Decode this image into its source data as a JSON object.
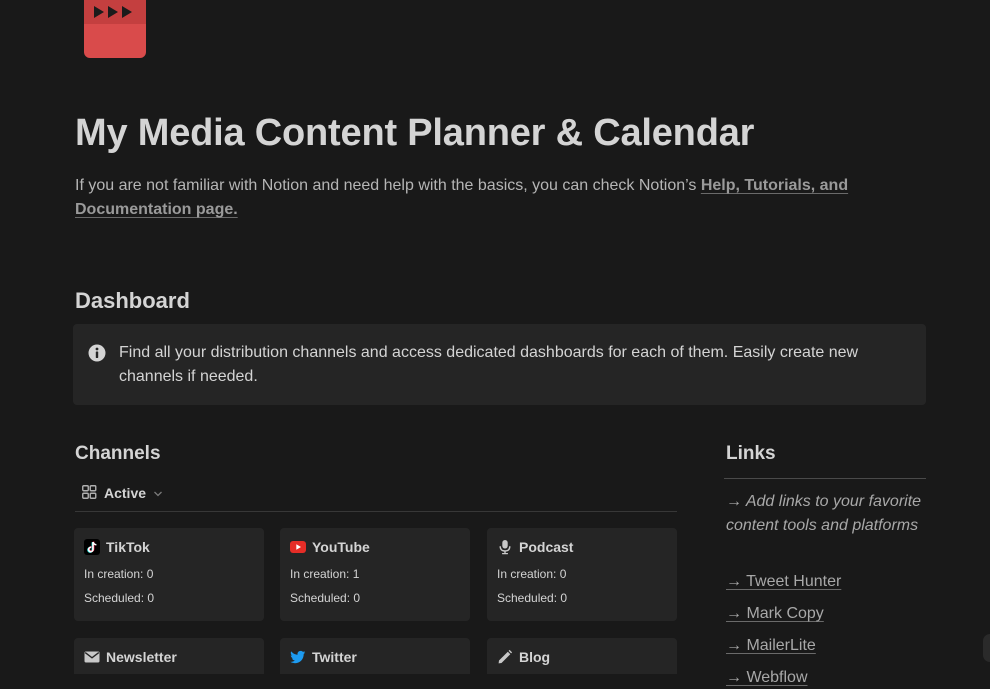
{
  "page": {
    "icon": "clapperboard-icon",
    "title": "My Media Content Planner & Calendar",
    "intro_text": "If you are not familiar with Notion and need help with the basics, you can check Notion’s ",
    "intro_link": "Help, Tutorials, and Documentation page."
  },
  "dashboard": {
    "heading": "Dashboard",
    "callout_icon": "info-icon",
    "callout_text": "Find all your distribution channels and access dedicated dashboards for each of them. Easily create new channels if needed."
  },
  "channels": {
    "heading": "Channels",
    "view_icon": "gallery-icon",
    "view_label": "Active",
    "cards": [
      {
        "name": "TikTok",
        "icon": "tiktok-icon",
        "in_creation": "In creation: 0",
        "scheduled": "Scheduled: 0"
      },
      {
        "name": "YouTube",
        "icon": "youtube-icon",
        "in_creation": "In creation: 1",
        "scheduled": "Scheduled: 0"
      },
      {
        "name": "Podcast",
        "icon": "microphone-icon",
        "in_creation": "In creation: 0",
        "scheduled": "Scheduled: 0"
      },
      {
        "name": "Newsletter",
        "icon": "envelope-icon"
      },
      {
        "name": "Twitter",
        "icon": "twitter-icon"
      },
      {
        "name": "Blog",
        "icon": "pencil-icon"
      }
    ]
  },
  "links": {
    "heading": "Links",
    "note": "→ Add links to your favorite content tools and platforms",
    "items": [
      "→ Tweet Hunter",
      "→ Mark Copy",
      "→ MailerLite",
      "→ Webflow"
    ]
  },
  "colors": {
    "background": "#191919",
    "card": "#252525",
    "text": "#d4d4d4",
    "icon_red": "#d94b4b",
    "youtube_red": "#e52d27",
    "twitter_blue": "#1d9bf0"
  }
}
